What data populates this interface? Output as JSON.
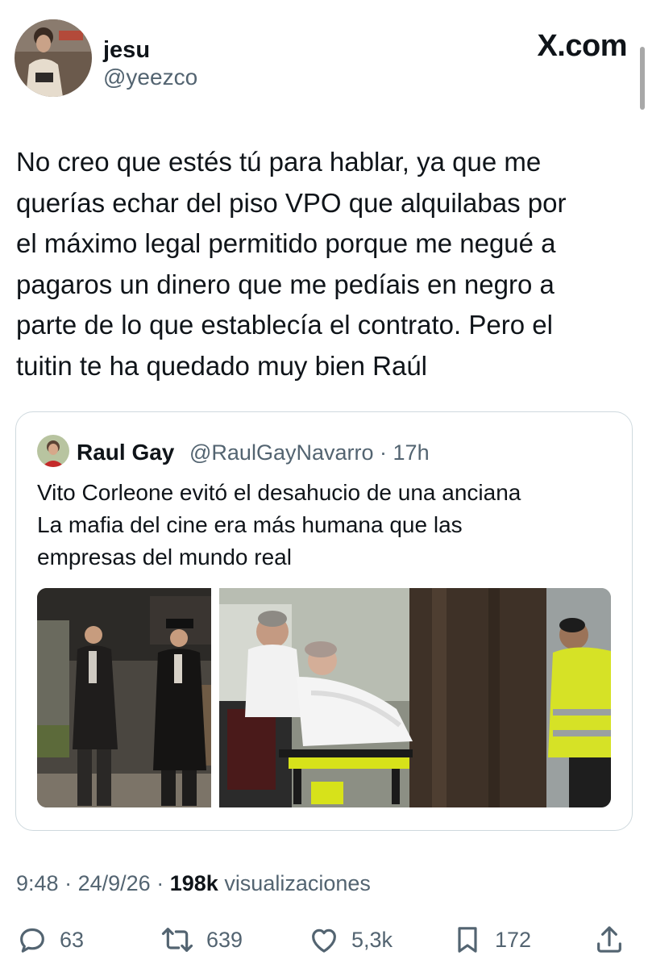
{
  "author": {
    "name": "jesu",
    "handle": "@yeezco"
  },
  "brand": "X.com",
  "tweet": {
    "lines": [
      "No creo que estés tú para hablar, ya que me",
      "querías echar del piso VPO que alquilabas por",
      "el máximo legal permitido porque me negué a",
      "pagaros un dinero que me pedíais en negro a",
      "parte de lo que establecía el contrato. Pero el",
      "tuitin te ha quedado muy bien Raúl"
    ]
  },
  "quote": {
    "name": "Raul Gay",
    "handle": "@RaulGayNavarro",
    "separator": "·",
    "time": "17h",
    "lines": [
      "Vito Corleone evitó el desahucio de una anciana",
      "La mafia del cine era más humana que las",
      "empresas del mundo real"
    ]
  },
  "meta": {
    "time": "9:48",
    "sep1": "·",
    "date": "24/9/26",
    "sep2": "·",
    "views": "198k",
    "views_label": "visualizaciones"
  },
  "actions": {
    "replies": "63",
    "reposts": "639",
    "likes": "5,3k",
    "bookmarks": "172"
  },
  "icons": {
    "reply": "reply-icon",
    "repost": "repost-icon",
    "like": "heart-icon",
    "bookmark": "bookmark-icon",
    "share": "share-icon"
  }
}
